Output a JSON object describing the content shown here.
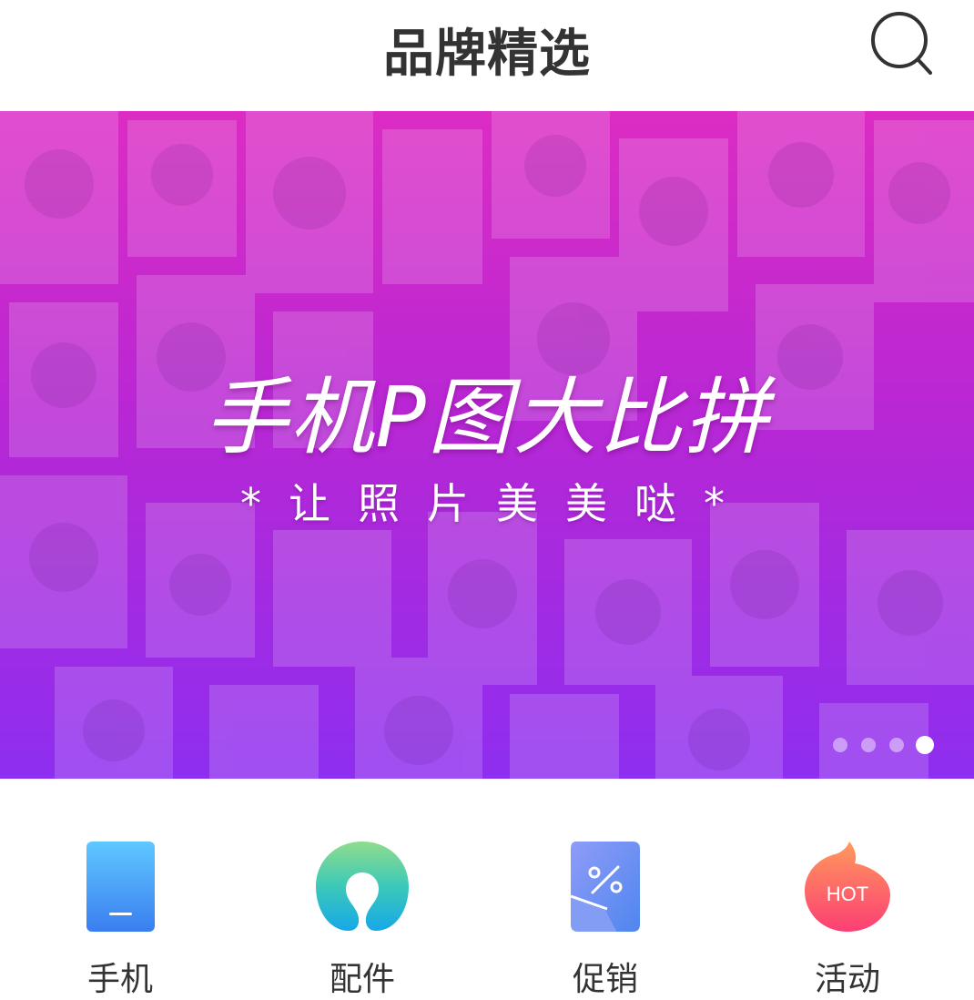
{
  "header": {
    "title": "品牌精选",
    "search_icon": "search-icon"
  },
  "banner": {
    "title": "手机P图大比拼",
    "subtitle": "*让照片美美哒*",
    "slide_count": 4,
    "active_slide": 4,
    "gradient": [
      "#dc2cc4",
      "#b827d4",
      "#8e2ef0"
    ]
  },
  "categories": [
    {
      "label": "手机",
      "icon": "phone-icon",
      "color": "#3f8ef3"
    },
    {
      "label": "配件",
      "icon": "accessory-icon",
      "color": "#22c4d6"
    },
    {
      "label": "促销",
      "icon": "promotion-percent-icon",
      "color": "#6b8af0"
    },
    {
      "label": "活动",
      "icon": "hot-flame-icon",
      "color": "#fa4a6e",
      "badge": "HOT"
    }
  ]
}
